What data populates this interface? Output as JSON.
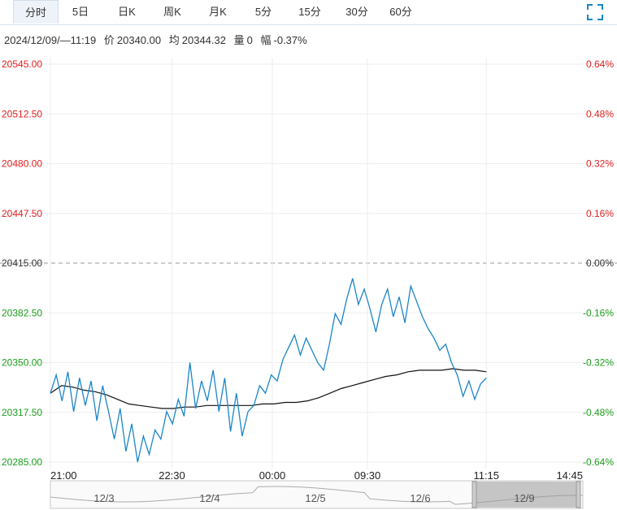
{
  "tabs": [
    {
      "label": "分时",
      "active": true
    },
    {
      "label": "5日"
    },
    {
      "label": "日K"
    },
    {
      "label": "周K"
    },
    {
      "label": "月K"
    },
    {
      "label": "5分"
    },
    {
      "label": "15分"
    },
    {
      "label": "30分"
    },
    {
      "label": "60分"
    }
  ],
  "fullscreen_icon": "expand-icon",
  "info": {
    "datetime": "2024/12/09/—11:19",
    "price_label": "价",
    "price_value": "20340.00",
    "avg_label": "均",
    "avg_value": "20344.32",
    "vol_label": "量",
    "vol_value": "0",
    "chg_label": "幅",
    "chg_value": "-0.37%"
  },
  "colors": {
    "price_line": "#1a86c8",
    "avg_line": "#111111",
    "up": "#e02020",
    "down": "#1c9e1c",
    "prev_close_dash": "#999999"
  },
  "chart_data": {
    "type": "line",
    "ylim": [
      20285.0,
      20545.0
    ],
    "prev_close": 20415.0,
    "y_ticks": [
      "20545.00",
      "20512.50",
      "20480.00",
      "20447.50",
      "20415.00",
      "20382.50",
      "20350.00",
      "20317.50",
      "20285.00"
    ],
    "pct_ticks": [
      "0.64%",
      "0.48%",
      "0.32%",
      "0.16%",
      "0.00%",
      "-0.16%",
      "-0.32%",
      "-0.48%",
      "-0.64%"
    ],
    "x_ticks": [
      "21:00",
      "22:30",
      "00:00",
      "09:30",
      "11:15",
      "14:45"
    ],
    "session_fraction_x": [
      0,
      0.23,
      0.42,
      0.6,
      0.825,
      1
    ],
    "x": [
      0,
      0.01,
      0.02,
      0.03,
      0.04,
      0.05,
      0.06,
      0.07,
      0.08,
      0.09,
      0.1,
      0.11,
      0.12,
      0.13,
      0.14,
      0.15,
      0.16,
      0.17,
      0.18,
      0.19,
      0.2,
      0.21,
      0.22,
      0.23,
      0.24,
      0.25,
      0.26,
      0.27,
      0.28,
      0.29,
      0.3,
      0.31,
      0.32,
      0.33,
      0.34,
      0.35,
      0.36,
      0.37,
      0.38,
      0.39,
      0.4,
      0.41,
      0.42,
      0.43,
      0.44,
      0.45,
      0.46,
      0.47,
      0.48,
      0.49,
      0.5,
      0.51,
      0.52,
      0.53,
      0.54,
      0.55,
      0.56,
      0.57,
      0.58,
      0.59,
      0.6,
      0.61,
      0.62,
      0.63,
      0.64,
      0.65,
      0.66,
      0.67,
      0.68,
      0.69,
      0.7,
      0.71,
      0.72,
      0.73,
      0.74,
      0.75,
      0.76,
      0.77,
      0.78,
      0.79,
      0.8,
      0.805,
      0.81,
      0.815,
      0.82
    ],
    "series": [
      {
        "role": "price",
        "values": [
          20330,
          20342,
          20325,
          20344,
          20318,
          20340,
          20322,
          20338,
          20312,
          20335,
          20318,
          20300,
          20320,
          20292,
          20310,
          20285,
          20302,
          20290,
          20306,
          20300,
          20318,
          20310,
          20326,
          20315,
          20350,
          20320,
          20338,
          20325,
          20345,
          20318,
          20340,
          20305,
          20330,
          20302,
          20318,
          20322,
          20335,
          20330,
          20342,
          20338,
          20352,
          20360,
          20368,
          20355,
          20366,
          20358,
          20350,
          20345,
          20362,
          20382,
          20375,
          20392,
          20405,
          20388,
          20398,
          20385,
          20370,
          20388,
          20398,
          20380,
          20393,
          20376,
          20400,
          20390,
          20380,
          20372,
          20366,
          20358,
          20362,
          20350,
          20342,
          20328,
          20338,
          20326,
          20336,
          20340
        ],
        "count": 76
      },
      {
        "role": "average",
        "values": [
          20330,
          20335,
          20334,
          20332,
          20331,
          20329,
          20326,
          20323,
          20322,
          20321,
          20320,
          20320,
          20321,
          20321,
          20322,
          20322,
          20322,
          20322,
          20322,
          20323,
          20323,
          20324,
          20324,
          20325,
          20327,
          20330,
          20333,
          20335,
          20337,
          20339,
          20341,
          20342,
          20344,
          20345,
          20345,
          20345,
          20346,
          20345,
          20345,
          20344
        ],
        "count": 40
      }
    ]
  },
  "navigator": {
    "labels": [
      "12/3",
      "12/4",
      "12/5",
      "12/6",
      "12/9"
    ]
  }
}
